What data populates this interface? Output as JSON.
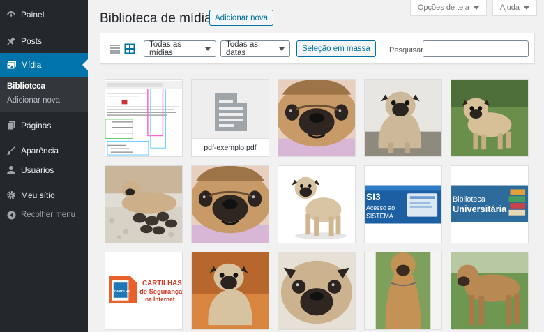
{
  "sidebar": {
    "items": [
      {
        "label": "Painel",
        "icon": "dashboard-icon"
      },
      {
        "label": "Posts",
        "icon": "pin-icon"
      },
      {
        "label": "Mídia",
        "icon": "media-icon",
        "active": true
      },
      {
        "label": "Páginas",
        "icon": "pages-icon"
      },
      {
        "label": "Aparência",
        "icon": "brush-icon"
      },
      {
        "label": "Usuários",
        "icon": "user-icon"
      },
      {
        "label": "Meu sítio",
        "icon": "gear-icon"
      },
      {
        "label": "Recolher menu",
        "icon": "collapse-icon"
      }
    ],
    "submenu": [
      {
        "label": "Biblioteca",
        "current": true
      },
      {
        "label": "Adicionar nova",
        "current": false
      }
    ]
  },
  "header": {
    "title": "Biblioteca de mídia",
    "add_new": "Adicionar nova",
    "screen_options": "Opções de tela",
    "help": "Ajuda"
  },
  "toolbar": {
    "type_filter": "Todas as mídias",
    "date_filter": "Todas as datas",
    "bulk_select": "Seleção em massa",
    "search_label": "Pesquisar",
    "search_value": ""
  },
  "grid": {
    "items": [
      {
        "kind": "document-screenshot"
      },
      {
        "kind": "pdf",
        "caption": "pdf-exemplo.pdf"
      },
      {
        "kind": "pug-face"
      },
      {
        "kind": "pug-puppy-sitting"
      },
      {
        "kind": "pug-standing-grass"
      },
      {
        "kind": "pug-mother-puppies"
      },
      {
        "kind": "pug-face"
      },
      {
        "kind": "pug-standing-white"
      },
      {
        "kind": "banner",
        "text": [
          "SI3",
          "Acesso ao",
          "SISTEMA"
        ]
      },
      {
        "kind": "banner",
        "text": [
          "Biblioteca",
          "Universitária"
        ]
      },
      {
        "kind": "banner-cartilhas",
        "text": [
          "CARTILHAS",
          "de Segurança",
          "na Internet"
        ],
        "sign": "CARTILHA"
      },
      {
        "kind": "pug-sitting-orange"
      },
      {
        "kind": "pug-face-close"
      },
      {
        "kind": "mastiff-front"
      },
      {
        "kind": "mastiff-side"
      }
    ]
  },
  "colors": {
    "sidebar_bg": "#23282d",
    "active": "#0073aa",
    "accent": "#0071a1"
  }
}
